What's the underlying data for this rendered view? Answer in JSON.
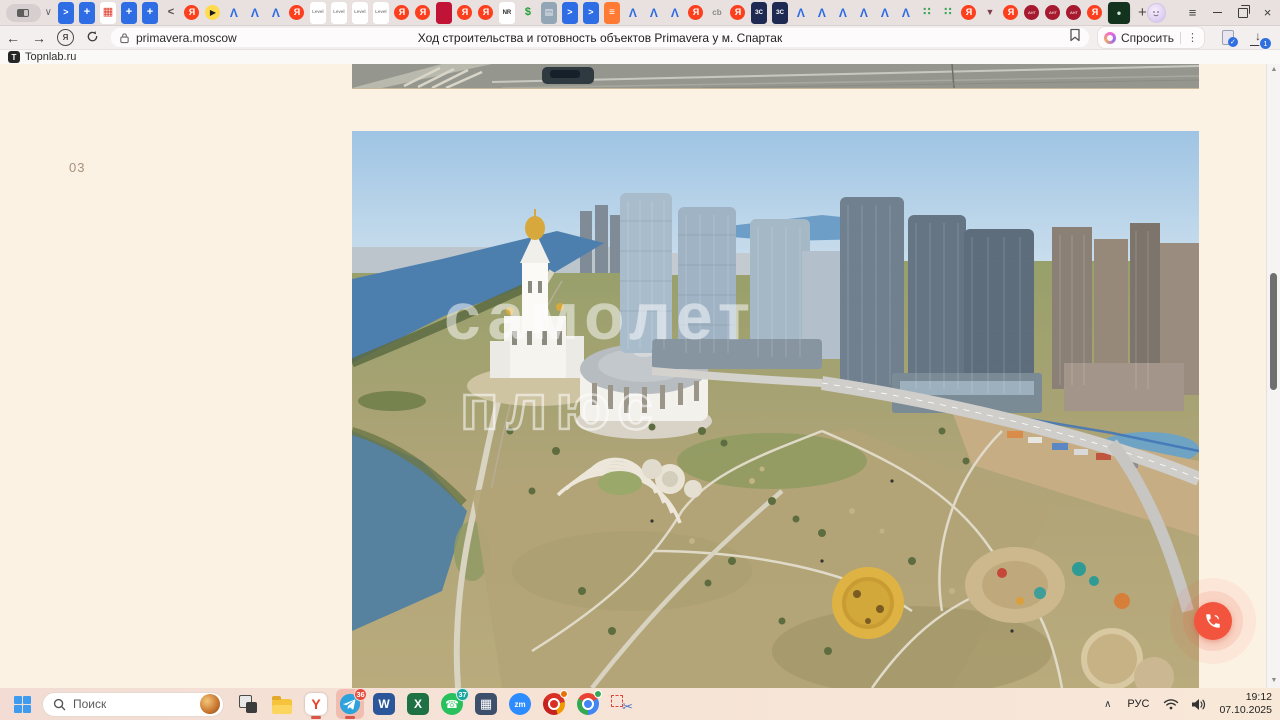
{
  "browser": {
    "page_title": "Ход строительства и готовность объектов Primavera у м. Спартак",
    "url": "primavera.moscow",
    "window_controls": {
      "menu": "≡",
      "close": "×"
    },
    "toolbar": {
      "back": "←",
      "forward": "→",
      "yandex_glyph": "Я",
      "ask_label": "Спросить",
      "more_glyph": "⋮",
      "download_glyph": "↓",
      "download_badge": "1"
    },
    "tabstrip": {
      "dropdown_glyph": "∨",
      "new_tab_glyph": "+",
      "tabs": [
        "blue-arrow",
        "blue-plus",
        "calculator",
        "blue-plus",
        "blue-plus",
        "angle",
        "yandex",
        "music",
        "peak",
        "peak",
        "peak",
        "yandex",
        "level",
        "level",
        "level",
        "level",
        "yandex",
        "yandex",
        "darkred",
        "yandex",
        "yandex",
        "nr",
        "sber",
        "grayblue",
        "blue-arrow",
        "blue-arrow",
        "orange",
        "peak",
        "peak",
        "peak",
        "yandex",
        "ob",
        "yandex",
        "zs",
        "zs",
        "peak",
        "peak",
        "peak",
        "peak",
        "peak",
        "peak",
        "dots",
        "dots",
        "yandex",
        "funnel",
        "yandex",
        "ant",
        "ant",
        "ant",
        "yandex",
        {
          "t": "primavera",
          "active": true
        }
      ]
    },
    "bookmarks": [
      {
        "label": "Topnlab.ru",
        "favicon_letter": "T"
      }
    ]
  },
  "favicon_styles": {
    "blue-arrow": {
      "bg": "#2e6de4",
      "fg": "#ffffff",
      "glyph": ">",
      "shape": "sq",
      "fs": 9,
      "bold": 1
    },
    "blue-plus": {
      "bg": "#2e6de4",
      "fg": "#ffffff",
      "glyph": "+",
      "shape": "sq",
      "fs": 11,
      "bold": 1
    },
    "calculator": {
      "bg": "#ffffff",
      "fg": "#e03a2a",
      "glyph": "▦",
      "shape": "sq",
      "fs": 11
    },
    "angle": {
      "bg": "transparent",
      "fg": "#4a4a4a",
      "glyph": "<",
      "fs": 11,
      "bold": 1
    },
    "yandex": {
      "bg": "#fc3f1d",
      "fg": "#ffffff",
      "glyph": "Я",
      "shape": "circle",
      "fs": 9,
      "bold": 1
    },
    "music": {
      "bg": "#ffdb4d",
      "fg": "#191919",
      "glyph": "▶",
      "shape": "circle",
      "fs": 8
    },
    "peak": {
      "bg": "transparent",
      "fg": "#2b6be4",
      "glyph": "Λ",
      "fs": 12,
      "bold": 1
    },
    "level": {
      "bg": "#ffffff",
      "fg": "#8a8a8a",
      "glyph": "Level",
      "shape": "sq",
      "fs": 4.5
    },
    "darkred": {
      "bg": "#c01335",
      "fg": "#c01335",
      "glyph": "",
      "shape": "sq"
    },
    "nr": {
      "bg": "#ffffff",
      "fg": "#2b2b2b",
      "glyph": "NR",
      "shape": "sq",
      "fs": 6,
      "bold": 1
    },
    "sber": {
      "bg": "transparent",
      "fg": "#1fa038",
      "glyph": "$",
      "fs": 11,
      "bold": 1
    },
    "grayblue": {
      "bg": "#93a6b6",
      "fg": "#e8edf1",
      "glyph": "▤",
      "shape": "sq",
      "fs": 9
    },
    "orange": {
      "bg": "#ff7b33",
      "fg": "#ffffff",
      "glyph": "≡",
      "shape": "sq",
      "fs": 10,
      "bold": 1
    },
    "ob": {
      "bg": "transparent",
      "fg": "#8a8a8a",
      "glyph": "cb",
      "fs": 8,
      "bold": 1
    },
    "zs": {
      "bg": "#1e2a52",
      "fg": "#ffffff",
      "glyph": "ЗС",
      "shape": "sq",
      "fs": 6,
      "bold": 1
    },
    "dots": {
      "bg": "transparent",
      "fg": "#35a854",
      "glyph": "∷",
      "fs": 11,
      "bold": 1
    },
    "funnel": {
      "bg": "transparent",
      "fg": "#7d3f4e",
      "glyph": "▼",
      "fs": 9
    },
    "ant": {
      "bg": "#a6192e",
      "fg": "#ffffff",
      "glyph": "АНТ",
      "shape": "circle",
      "fs": 4
    },
    "primavera": {
      "bg": "#14331f",
      "fg": "#cfe6d2",
      "glyph": "•",
      "shape": "sq",
      "fs": 12
    }
  },
  "page": {
    "section_number": "03",
    "watermark_line1": "самолет",
    "watermark_line2": "плюс",
    "fab_color": "#f2543d"
  },
  "scrollbar": {
    "up_glyph": "▲",
    "down_glyph": "▼"
  },
  "taskbar": {
    "search_label": "Поиск",
    "apps": [
      {
        "name": "task-view"
      },
      {
        "name": "explorer"
      },
      {
        "name": "yandex-browser",
        "glyph": "Y",
        "active": true
      },
      {
        "name": "telegram",
        "badge": "36",
        "badge_color": "#e34d3c",
        "highlighted": true,
        "active": true
      },
      {
        "name": "word",
        "glyph": "W",
        "bg": "#2b579a"
      },
      {
        "name": "excel",
        "glyph": "X",
        "bg": "#1e7145"
      },
      {
        "name": "whatsapp",
        "glyph": "☎",
        "badge": "37",
        "badge_color": "#19a7a0"
      },
      {
        "name": "calculator",
        "glyph": "▦"
      },
      {
        "name": "zoom",
        "glyph": "zm",
        "bg": "#2d8cff"
      },
      {
        "name": "chrome-red",
        "dot": "#e8710a"
      },
      {
        "name": "chrome",
        "dot": "#34a853"
      },
      {
        "name": "snipping-tool",
        "glyph": "✂"
      }
    ],
    "tray": {
      "hidden_glyph": "∧",
      "language": "РУС",
      "time": "19:12",
      "date": "07.10.2025"
    }
  }
}
